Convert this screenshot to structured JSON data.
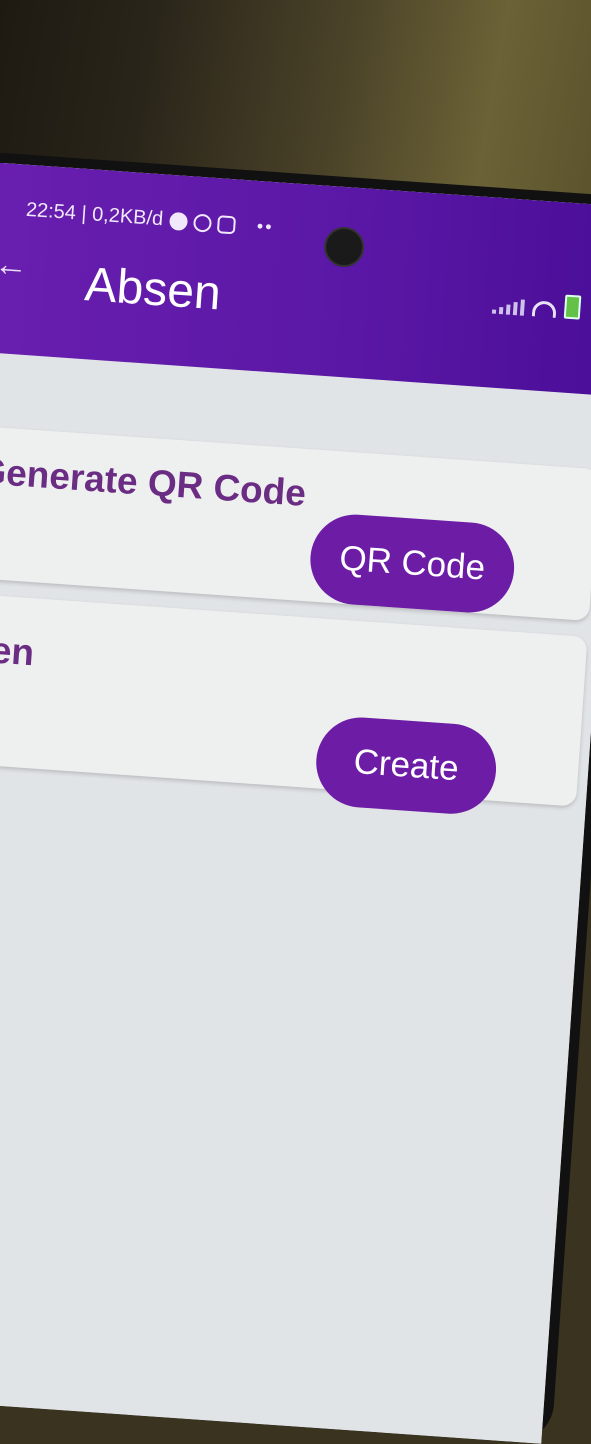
{
  "status_bar": {
    "time_data": "22:54 | 0,2KB/d",
    "dots": "••"
  },
  "app_bar": {
    "back_icon": "←",
    "title": "Absen"
  },
  "cards": [
    {
      "label": "Generate QR Code",
      "button": "QR Code"
    },
    {
      "label": "otulen",
      "button": "Create"
    }
  ],
  "colors": {
    "primary": "#6a1fb0",
    "button": "#6d1ca6",
    "label_text": "#6b2d83",
    "background": "#e1e4e7"
  }
}
